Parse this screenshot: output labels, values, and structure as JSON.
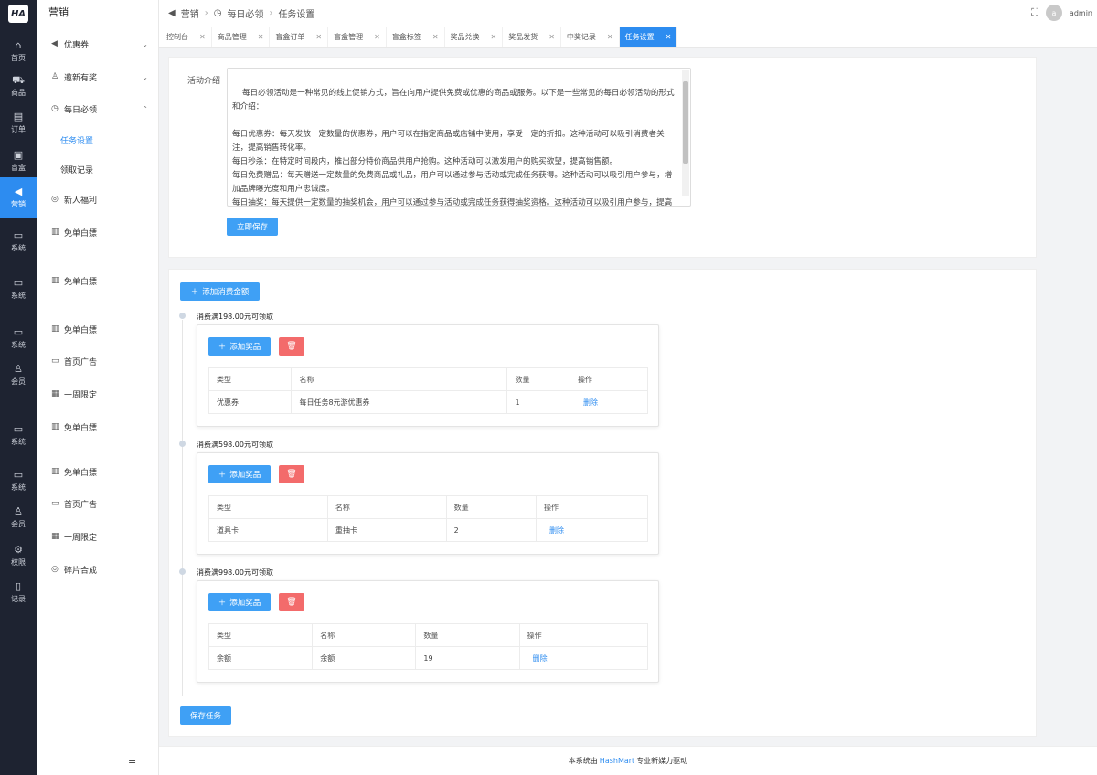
{
  "brand_logo": "HA",
  "rail": [
    {
      "label": "首页",
      "icon": "home-icon"
    },
    {
      "label": "商品",
      "icon": "cart-icon"
    },
    {
      "label": "订单",
      "icon": "order-icon"
    },
    {
      "label": "盲盒",
      "icon": "box-icon"
    },
    {
      "label": "营销",
      "icon": "bullhorn-icon"
    },
    {
      "label": "系统",
      "icon": "monitor-icon"
    },
    {
      "label": "系统",
      "icon": "monitor-icon"
    },
    {
      "label": "系统",
      "icon": "monitor-icon"
    },
    {
      "label": "会员",
      "icon": "user-icon"
    },
    {
      "label": "系统",
      "icon": "monitor-icon"
    },
    {
      "label": "系统",
      "icon": "monitor-icon"
    },
    {
      "label": "会员",
      "icon": "user-icon"
    },
    {
      "label": "权限",
      "icon": "gear-icon"
    },
    {
      "label": "记录",
      "icon": "tablet-icon"
    }
  ],
  "submenu": {
    "title": "营销",
    "items": [
      {
        "label": "优惠券",
        "icon": "bullhorn-icon"
      },
      {
        "label": "邀新有奖",
        "icon": "user-icon"
      },
      {
        "label": "每日必领",
        "icon": "clock-icon"
      },
      {
        "label": "任务设置"
      },
      {
        "label": "领取记录"
      },
      {
        "label": "新人福利",
        "icon": "globe-icon"
      },
      {
        "label": "免单白嫖",
        "icon": "chart-icon"
      },
      {
        "label": "免单白嫖",
        "icon": "chart-icon"
      },
      {
        "label": "免单白嫖",
        "icon": "chart-icon"
      },
      {
        "label": "首页广告",
        "icon": "monitor-icon"
      },
      {
        "label": "一周限定",
        "icon": "calendar-icon"
      },
      {
        "label": "免单白嫖",
        "icon": "chart-icon"
      },
      {
        "label": "免单白嫖",
        "icon": "chart-icon"
      },
      {
        "label": "首页广告",
        "icon": "monitor-icon"
      },
      {
        "label": "一周限定",
        "icon": "calendar-icon"
      },
      {
        "label": "碎片合成",
        "icon": "globe-icon"
      }
    ]
  },
  "breadcrumb": [
    "营销",
    "每日必领",
    "任务设置"
  ],
  "user": {
    "avatar": "a",
    "name": "admin"
  },
  "tabs": [
    "控制台",
    "商品管理",
    "盲盒订单",
    "盲盒管理",
    "盲盒标签",
    "奖品兑换",
    "奖品发货",
    "中奖记录",
    "任务设置"
  ],
  "intro": {
    "label": "活动介绍",
    "text": "每日必领活动是一种常见的线上促销方式，旨在向用户提供免费或优惠的商品或服务。以下是一些常见的每日必领活动的形式和介绍：\n\n每日优惠券：每天发放一定数量的优惠券，用户可以在指定商品或店铺中使用，享受一定的折扣。这种活动可以吸引消费者关注，提高销售转化率。\n每日秒杀：在特定时间段内，推出部分特价商品供用户抢购。这种活动可以激发用户的购买欲望，提高销售额。\n每日免费赠品：每天赠送一定数量的免费商品或礼品，用户可以通过参与活动或完成任务获得。这种活动可以吸引用户参与，增加品牌曝光度和用户忠诚度。\n每日抽奖：每天提供一定数量的抽奖机会，用户可以通过参与活动或完成任务获得抽奖资格。这种活动可以吸引用户参与，提高品牌曝光度和用户互动性。\n每日限时折扣：在特定时间段内，提供一定比例的折扣，用户可以在指定商品或店铺中使用。这种活动可以吸引用户的购买",
    "save_button": "立即保存"
  },
  "tasks": {
    "add_amount_button": "添加消费金额",
    "add_prize_button": "添加奖品",
    "save_button": "保存任务",
    "columns": [
      "类型",
      "名称",
      "数量",
      "操作"
    ],
    "tiers": [
      {
        "label": "消费满198.00元可领取",
        "rows": [
          {
            "type": "优惠券",
            "name": "每日任务8元游优惠券",
            "qty": "1",
            "op": "删除"
          }
        ]
      },
      {
        "label": "消费满598.00元可领取",
        "rows": [
          {
            "type": "道具卡",
            "name": "重抽卡",
            "qty": "2",
            "op": "删除"
          }
        ]
      },
      {
        "label": "消费满998.00元可领取",
        "rows": [
          {
            "type": "余额",
            "name": "余额",
            "qty": "19",
            "op": "删除"
          }
        ]
      }
    ]
  },
  "footer": {
    "prefix": "本系统由",
    "brand": "HashMart",
    "suffix": "专业新媒力驱动"
  },
  "colors": {
    "primary": "#2d8cf0",
    "danger": "#f36b6b",
    "rail_bg": "#1e2331"
  }
}
